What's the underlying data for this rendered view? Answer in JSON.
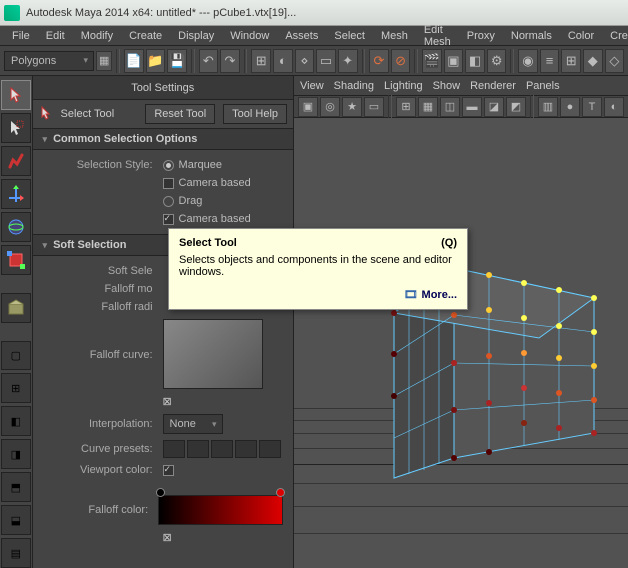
{
  "title": "Autodesk Maya 2014 x64: untitled*   ---   pCube1.vtx[19]...",
  "menus": [
    "File",
    "Edit",
    "Modify",
    "Create",
    "Display",
    "Window",
    "Assets",
    "Select",
    "Mesh",
    "Edit Mesh",
    "Proxy",
    "Normals",
    "Color",
    "Create"
  ],
  "shelf_dropdown": "Polygons",
  "settings_header": "Tool Settings",
  "tool_label": "Select Tool",
  "reset_btn": "Reset Tool",
  "help_btn": "Tool Help",
  "common_section": "Common Selection Options",
  "sel_style_lbl": "Selection Style:",
  "marquee": "Marquee",
  "camera_based": "Camera based",
  "drag": "Drag",
  "camera_based2": "Camera based",
  "soft_section": "Soft Selection",
  "soft_sel_lbl": "Soft Sele",
  "falloff_mode_lbl": "Falloff mo",
  "falloff_radius_lbl": "Falloff radi",
  "falloff_curve_lbl": "Falloff curve:",
  "interp_lbl": "Interpolation:",
  "interp_val": "None",
  "presets_lbl": "Curve presets:",
  "viewport_color_lbl": "Viewport color:",
  "falloff_color_lbl": "Falloff color:",
  "vp_menus": [
    "View",
    "Shading",
    "Lighting",
    "Show",
    "Renderer",
    "Panels"
  ],
  "tooltip": {
    "title": "Select Tool",
    "shortcut": "(Q)",
    "body": "Selects objects and components in the scene and editor windows.",
    "more": "More..."
  }
}
